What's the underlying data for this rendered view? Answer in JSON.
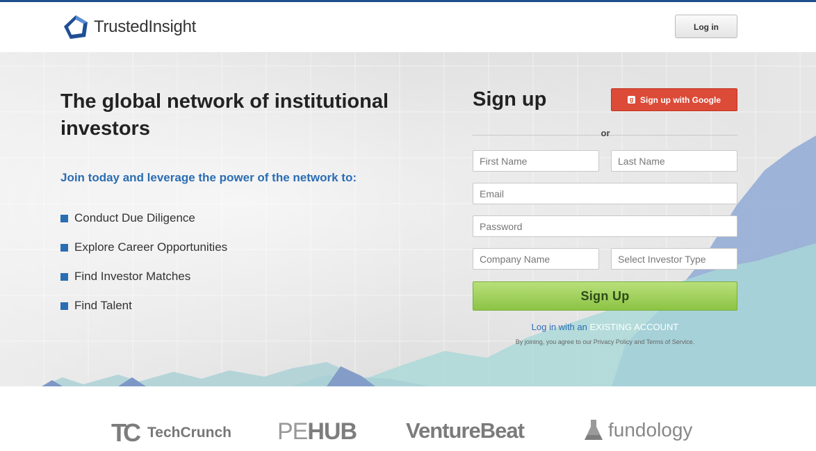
{
  "header": {
    "brand": "TrustedInsight",
    "login_label": "Log in"
  },
  "hero": {
    "headline": "The global network of institutional investors",
    "tagline": "Join today and leverage the power of the network to:",
    "features": [
      "Conduct Due Diligence",
      "Explore Career Opportunities",
      "Find Investor Matches",
      "Find Talent"
    ]
  },
  "signup": {
    "title": "Sign up",
    "google_label": "Sign up with Google",
    "or_label": "or",
    "first_name_placeholder": "First Name",
    "last_name_placeholder": "Last Name",
    "email_placeholder": "Email",
    "password_placeholder": "Password",
    "company_placeholder": "Company Name",
    "investor_type_placeholder": "Select Investor Type",
    "submit_label": "Sign Up",
    "existing_lead": "Log in with an ",
    "existing_cta": "EXISTING ACCOUNT",
    "terms": "By joining, you agree to our Privacy Policy and Terms of Service."
  },
  "press": {
    "techcrunch": "TechCrunch",
    "techcrunch_mark": "TC",
    "pehub_pe": "PE",
    "pehub_hub": "HUB",
    "venturebeat": "VentureBeat",
    "fundology": "fundology"
  },
  "colors": {
    "brand_blue": "#2a6db3",
    "google_red": "#dc4a38",
    "signup_green": "#8cc445",
    "top_rule": "#1e4e8c"
  }
}
